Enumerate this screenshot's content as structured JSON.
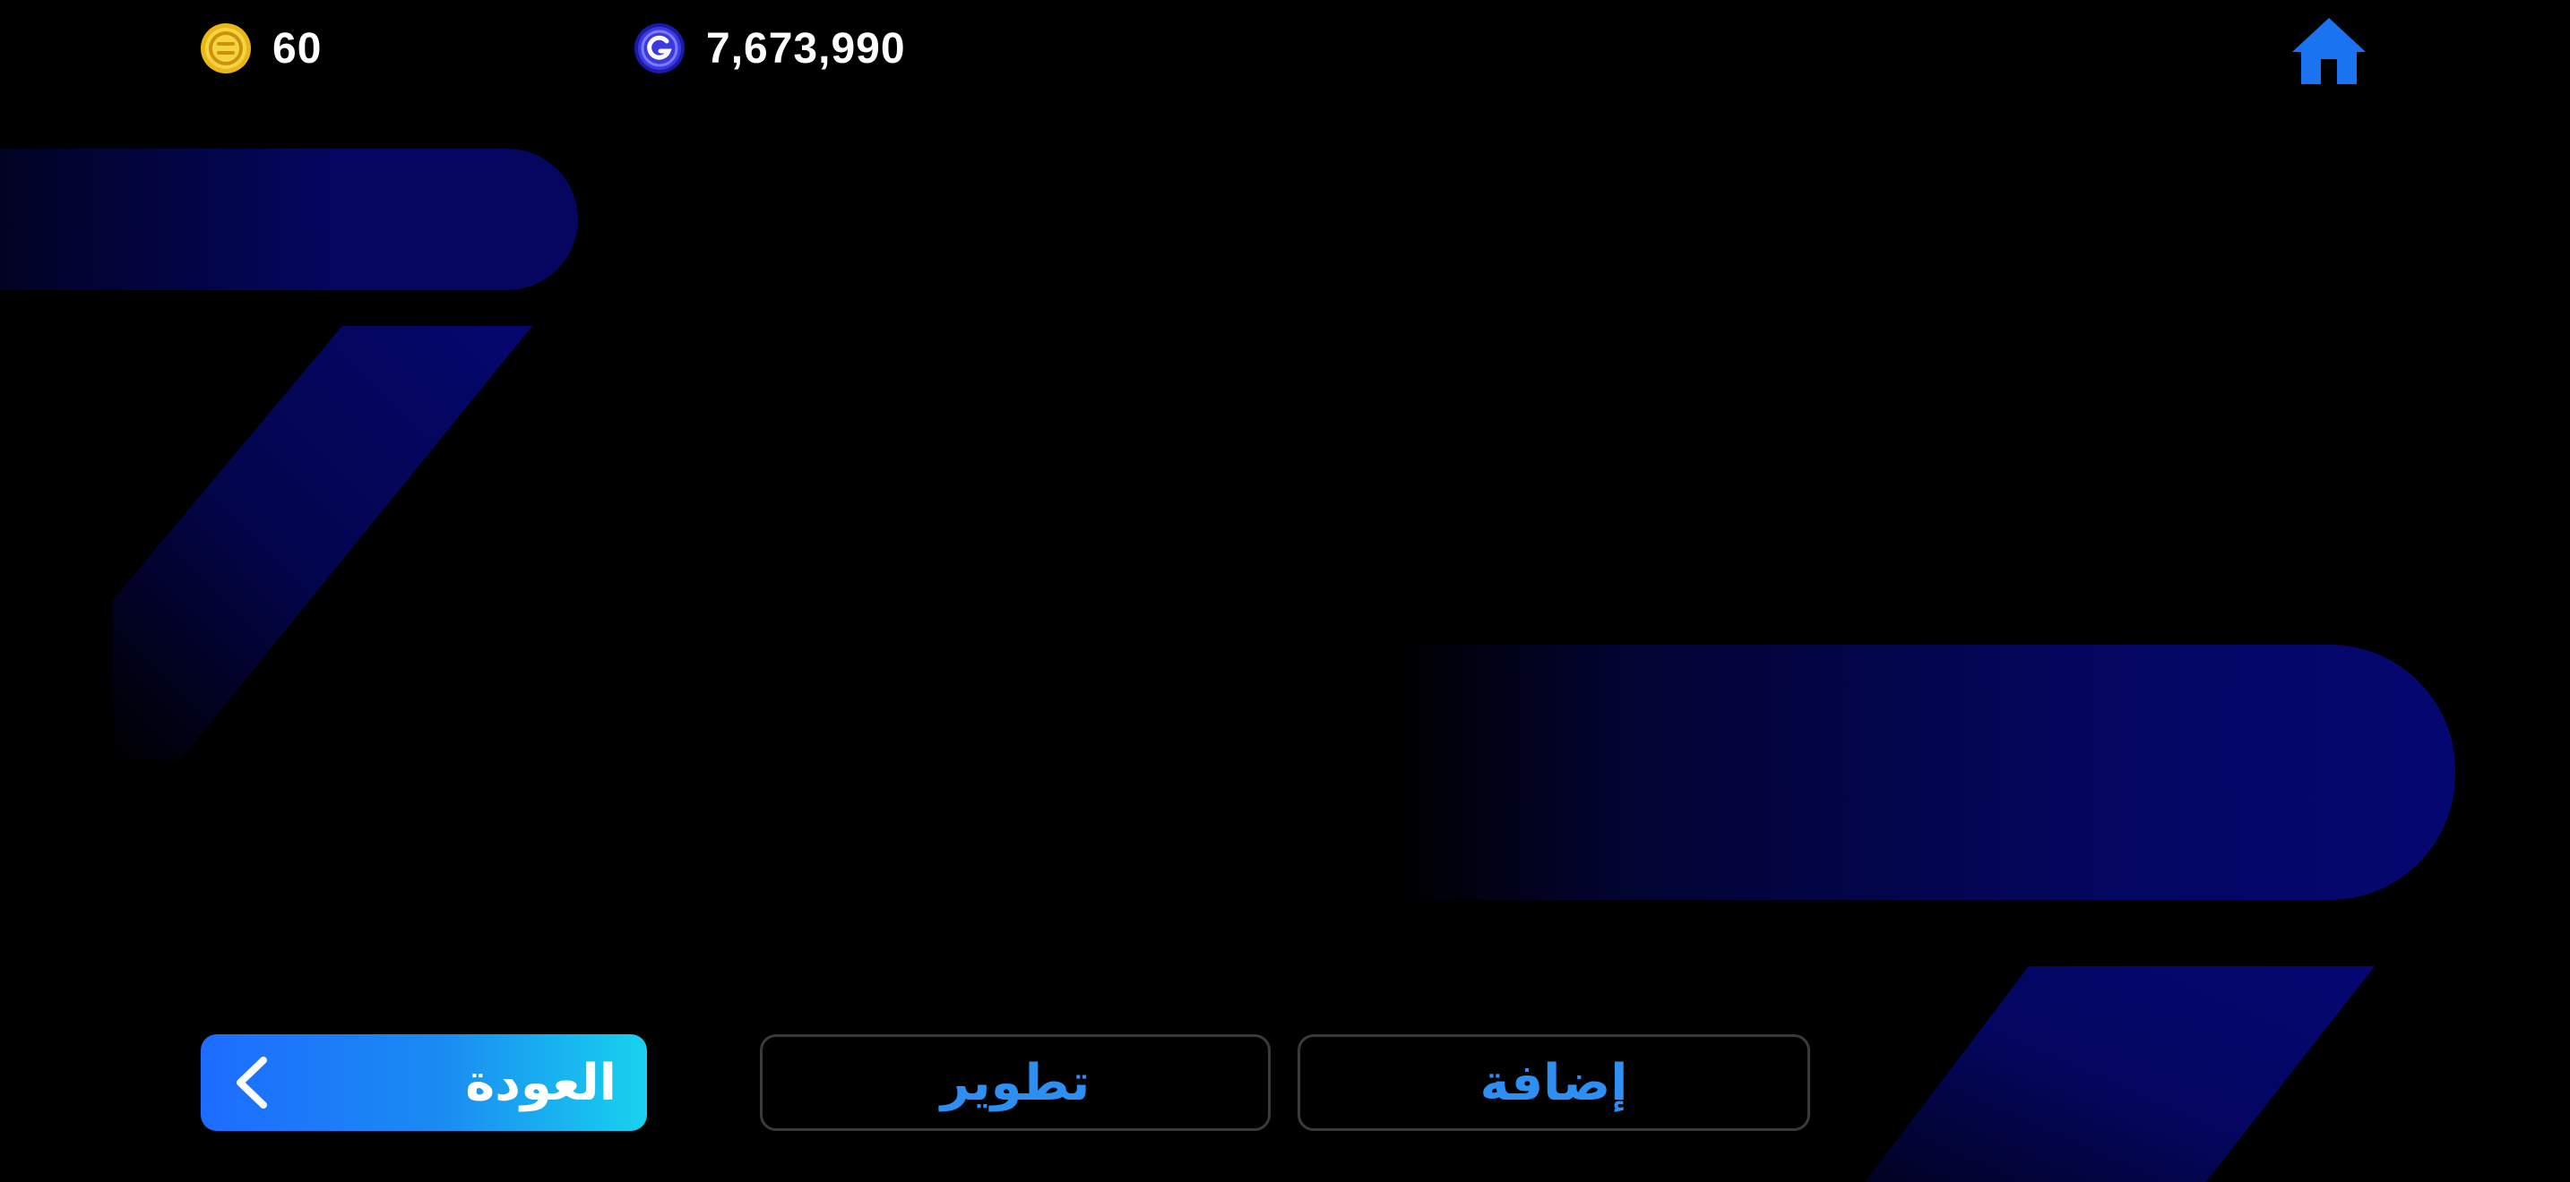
{
  "hud": {
    "coins": {
      "icon": "gold-coin-icon",
      "value": "60"
    },
    "gems": {
      "icon": "g-token-icon",
      "value": "7,673,990"
    },
    "home": {
      "icon": "home-icon"
    }
  },
  "actions": {
    "back_label": "العودة",
    "upgrade_label": "تطوير",
    "add_label": "إضافة"
  },
  "colors": {
    "background": "#000000",
    "accent_blue": "#2d8ff2",
    "back_gradient_start": "#1d6cff",
    "back_gradient_end": "#18d2ee",
    "deco_navy": "#040660",
    "coin_gold": "#f2c21a",
    "token_blue": "#2f2fd8"
  }
}
